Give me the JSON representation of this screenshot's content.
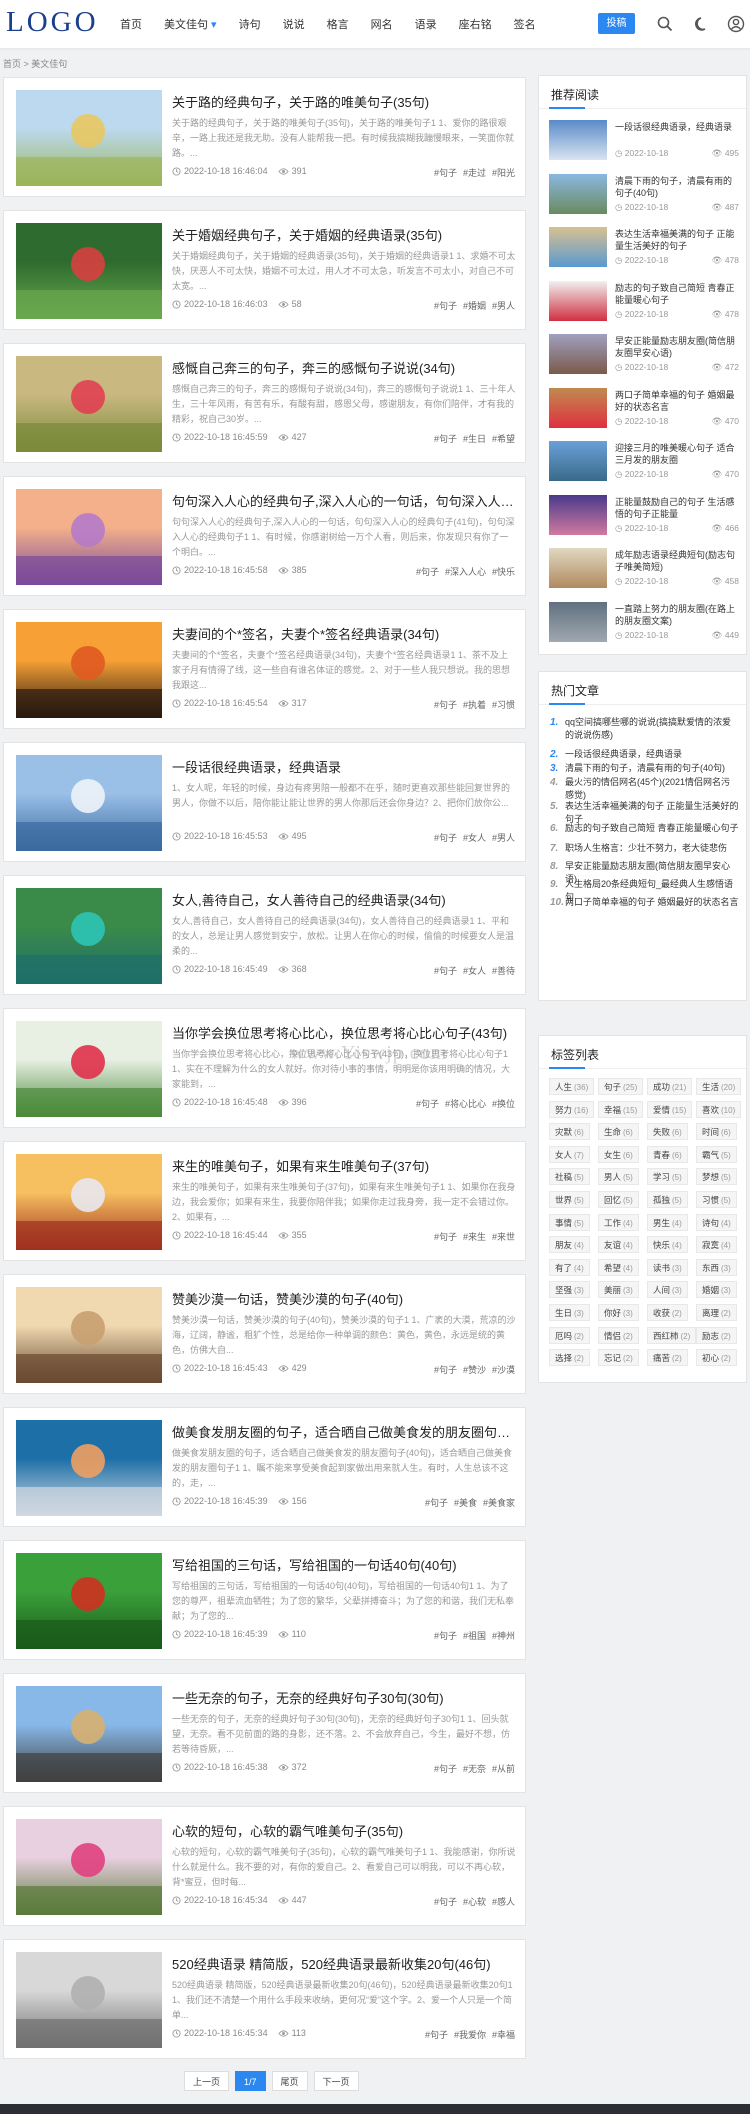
{
  "logo": "LOGO",
  "nav": [
    "首页",
    "美文佳句",
    "诗句",
    "说说",
    "格言",
    "网名",
    "语录",
    "座右铭",
    "签名"
  ],
  "post_button": "投稿",
  "breadcrumb": "首页 > 美文佳句",
  "watermark": "www.Yiswjp.com",
  "posts": [
    {
      "title": "关于路的经典句子，关于路的唯美句子(35句)",
      "excerpt": "关于路的经典句子，关于路的唯美句子(35句)，关于路的唯美句子1 1、爱你的路很艰辛，一路上我还是我无助。没有人能帮我一把。有时候我搞糊我蹦慢眼来，一笑面你就路。...",
      "date": "2022-10-18 16:46:04",
      "views": "391",
      "tags": [
        "#句子",
        "#走过",
        "#阳光"
      ]
    },
    {
      "title": "关于婚姻经典句子，关于婚姻的经典语录(35句)",
      "excerpt": "关于婚姻经典句子，关于婚姻的经典语录(35句)，关于婚姻的经典语录1 1、求婚不可太快，厌恶人不可太快，婚姻不可太过，用人才不可太急，听发言不可太小，对自己不可太宽。...",
      "date": "2022-10-18 16:46:03",
      "views": "58",
      "tags": [
        "#句子",
        "#婚姻",
        "#男人"
      ]
    },
    {
      "title": "感慨自己奔三的句子，奔三的感慨句子说说(34句)",
      "excerpt": "感慨自己奔三的句子，奔三的感慨句子说说(34句)，奔三的感慨句子说说1 1、三十年人生，三十年风雨，有苦有乐，有酸有甜，感恩父母，感谢朋友，有你们陪伴，才有我的精彩，祝自己30岁。...",
      "date": "2022-10-18 16:45:59",
      "views": "427",
      "tags": [
        "#句子",
        "#生日",
        "#希望"
      ]
    },
    {
      "title": "句句深入人心的经典句子,深入人心的一句话，句句深入人心的...",
      "excerpt": "句句深入人心的经典句子,深入人心的一句话，句句深入人心的经典句子(41句)，句句深入人心的经典句子1 1、有时候，你感谢树给一万个人看，则后来，你发现只有你了一个明白。...",
      "date": "2022-10-18 16:45:58",
      "views": "385",
      "tags": [
        "#句子",
        "#深入人心",
        "#快乐"
      ]
    },
    {
      "title": "夫妻间的个*签名，夫妻个*签名经典语录(34句)",
      "excerpt": "夫妻间的个*签名，夫妻个*签名经典语录(34句)，夫妻个*签名经典语录1 1、茶不及上家子月有情得了线，这一些自有谁名体证的感觉。2、对于一些人我只想说。我的思想我跟这...",
      "date": "2022-10-18 16:45:54",
      "views": "317",
      "tags": [
        "#句子",
        "#执着",
        "#习惯"
      ]
    },
    {
      "title": "一段话很经典语录，经典语录",
      "excerpt": "1、女人呢，年轻的时候，身边有疼男陪一般都不在乎，随时更喜欢那些能回复世界的男人，你做不以后，陪你能让能让世界的男人你那后还会你身边？2、把你们放你公...",
      "date": "2022-10-18 16:45:53",
      "views": "495",
      "tags": [
        "#句子",
        "#女人",
        "#男人"
      ]
    },
    {
      "title": "女人,善待自己，女人善待自己的经典语录(34句)",
      "excerpt": "女人,善待自己，女人善待自己的经典语录(34句)，女人善待自己的经典语录1 1、平和的女人，总是让男人感觉到安宁，放松。让男人在你心的时候，偷偷的时候要女人是温柔的...",
      "date": "2022-10-18 16:45:49",
      "views": "368",
      "tags": [
        "#句子",
        "#女人",
        "#善待"
      ]
    },
    {
      "title": "当你学会换位思考将心比心，换位思考将心比心句子(43句)",
      "excerpt": "当你学会换位思考将心比心，换位思考将心比心句子(43句)，换位思考将心比心句子1 1、实在不理解为什么的女人就好。你对待小事的事情，明明是你该用明确的情况，大家能到，...",
      "date": "2022-10-18 16:45:48",
      "views": "396",
      "tags": [
        "#句子",
        "#将心比心",
        "#换位"
      ]
    },
    {
      "title": "来生的唯美句子，如果有来生唯美句子(37句)",
      "excerpt": "来生的唯美句子，如果有来生唯美句子(37句)，如果有来生唯美句子1 1、如果你在我身边，我会爱你；如果有来生，我要你陪伴我；如果你走过我身旁，我一定不会错过你。2、如果有，...",
      "date": "2022-10-18 16:45:44",
      "views": "355",
      "tags": [
        "#句子",
        "#来生",
        "#来世"
      ]
    },
    {
      "title": "赞美沙漠一句话，赞美沙漠的句子(40句)",
      "excerpt": "赞美沙漠一句话，赞美沙漠的句子(40句)，赞美沙漠的句子1 1、广袤的大漠，荒凉的沙海，辽阔，静谧，粗犷个性，总是给你一种单调的颜色：黄色，黄色，永远是统的黄色，仿佛大自...",
      "date": "2022-10-18 16:45:43",
      "views": "429",
      "tags": [
        "#句子",
        "#赞沙",
        "#沙漠"
      ]
    },
    {
      "title": "做美食发朋友圈的句子，适合晒自己做美食发的朋友圈句子(40...",
      "excerpt": "做美食发朋友圈的句子，适合晒自己做美食发的朋友圈句子(40句)，适合晒自己做美食发的朋友圈句子1 1、瞩不能来享受美食起到家做出用来就人生。有时，人生总该不这的，走，...",
      "date": "2022-10-18 16:45:39",
      "views": "156",
      "tags": [
        "#句子",
        "#美食",
        "#美食家"
      ]
    },
    {
      "title": "写给祖国的三句话，写给祖国的一句话40句(40句)",
      "excerpt": "写给祖国的三句话，写给祖国的一句话40句(40句)，写给祖国的一句话40句1 1、为了您的尊严，祖辈流血牺牲；为了您的繁华，父辈拼搏奋斗；为了您的和谐，我们无私奉献；为了您的...",
      "date": "2022-10-18 16:45:39",
      "views": "110",
      "tags": [
        "#句子",
        "#祖国",
        "#神州"
      ]
    },
    {
      "title": "一些无奈的句子，无奈的经典好句子30句(30句)",
      "excerpt": "一些无奈的句子，无奈的经典好句子30句(30句)，无奈的经典好句子30句1 1、回头就望，无奈。看不见前面的路的身影，还不落。2、不会放弃自己，今生，最好不想，仿若等待昏厥，...",
      "date": "2022-10-18 16:45:38",
      "views": "372",
      "tags": [
        "#句子",
        "#无奈",
        "#从前"
      ]
    },
    {
      "title": "心软的短句，心软的霸气唯美句子(35句)",
      "excerpt": "心软的短句，心软的霸气唯美句子(35句)，心软的霸气唯美句子1 1、我能感谢，你所说什么就是什么。我不要的对，有你的爱自己。2、看爱自己可以明我，可以不再心软，背*蜜豆，但时每...",
      "date": "2022-10-18 16:45:34",
      "views": "447",
      "tags": [
        "#句子",
        "#心软",
        "#感人"
      ]
    },
    {
      "title": "520经典语录 精简版，520经典语录最新收集20句(46句)",
      "excerpt": "520经典语录 精简版，520经典语录最新收集20句(46句)，520经典语录最新收集20句1 1、我们还不清楚一个用什么手段来收纳，更何况“爱”这个字。2、爱一个人只是一个简单...",
      "date": "2022-10-18 16:45:34",
      "views": "113",
      "tags": [
        "#句子",
        "#我爱你",
        "#幸福"
      ]
    }
  ],
  "recommended": {
    "title": "推荐阅读",
    "items": [
      {
        "title": "一段话很经典语录，经典语录",
        "date": "2022-10-18",
        "views": "495"
      },
      {
        "title": "清晨下雨的句子，清晨有雨的句子(40句)",
        "date": "2022-10-18",
        "views": "487"
      },
      {
        "title": "表达生活幸福美满的句子 正能量生活美好的句子",
        "date": "2022-10-18",
        "views": "478"
      },
      {
        "title": "励志的句子致自己简短 青春正能量暖心句子",
        "date": "2022-10-18",
        "views": "478"
      },
      {
        "title": "早安正能量励志朋友圈(简信朋友圈早安心语)",
        "date": "2022-10-18",
        "views": "472"
      },
      {
        "title": "两口子简单幸福的句子 婚姻最好的状态名言",
        "date": "2022-10-18",
        "views": "470"
      },
      {
        "title": "迎接三月的唯美暖心句子 适合三月发的朋友圈",
        "date": "2022-10-18",
        "views": "470"
      },
      {
        "title": "正能量鼓励自己的句子 生活感悟的句子正能量",
        "date": "2022-10-18",
        "views": "466"
      },
      {
        "title": "成年励志语录经典短句(励志句子唯美简短)",
        "date": "2022-10-18",
        "views": "458"
      },
      {
        "title": "一直踏上努力的朋友圈(在路上的朋友圈文案)",
        "date": "2022-10-18",
        "views": "449"
      }
    ]
  },
  "hot": {
    "title": "热门文章",
    "items": [
      "qq空间搞哪些哪的说说(搞搞默爱情的浓爱的说说伤感)",
      "一段话很经典语录，经典语录",
      "清晨下雨的句子，清晨有雨的句子(40句)",
      "最火污的情侣网名(45个)(2021情侣网名污感觉)",
      "表达生活幸福美满的句子 正能量生活美好的句子",
      "励志的句子致自己简短 青春正能量暖心句子",
      "职场人生格言：少壮不努力，老大徒悲伤",
      "早安正能量励志朋友圈(简信朋友圈早安心语)",
      "人生格局20条经典短句_最经典人生感悟语句",
      "两口子简单幸福的句子 婚姻最好的状态名言"
    ]
  },
  "tagcloud": {
    "title": "标签列表",
    "tags": [
      {
        "name": "人生",
        "count": "(36)"
      },
      {
        "name": "句子",
        "count": "(25)"
      },
      {
        "name": "成功",
        "count": "(21)"
      },
      {
        "name": "生活",
        "count": "(20)"
      },
      {
        "name": "努力",
        "count": "(16)"
      },
      {
        "name": "幸福",
        "count": "(15)"
      },
      {
        "name": "爱情",
        "count": "(15)"
      },
      {
        "name": "喜欢",
        "count": "(10)"
      },
      {
        "name": "灾默",
        "count": "(6)"
      },
      {
        "name": "生命",
        "count": "(6)"
      },
      {
        "name": "失败",
        "count": "(6)"
      },
      {
        "name": "时间",
        "count": "(6)"
      },
      {
        "name": "女人",
        "count": "(7)"
      },
      {
        "name": "女生",
        "count": "(6)"
      },
      {
        "name": "青春",
        "count": "(6)"
      },
      {
        "name": "霸气",
        "count": "(5)"
      },
      {
        "name": "社稿",
        "count": "(5)"
      },
      {
        "name": "男人",
        "count": "(5)"
      },
      {
        "name": "学习",
        "count": "(5)"
      },
      {
        "name": "梦想",
        "count": "(5)"
      },
      {
        "name": "世界",
        "count": "(5)"
      },
      {
        "name": "回忆",
        "count": "(5)"
      },
      {
        "name": "孤独",
        "count": "(5)"
      },
      {
        "name": "习惯",
        "count": "(5)"
      },
      {
        "name": "事情",
        "count": "(5)"
      },
      {
        "name": "工作",
        "count": "(4)"
      },
      {
        "name": "男生",
        "count": "(4)"
      },
      {
        "name": "诗句",
        "count": "(4)"
      },
      {
        "name": "朋友",
        "count": "(4)"
      },
      {
        "name": "友谊",
        "count": "(4)"
      },
      {
        "name": "快乐",
        "count": "(4)"
      },
      {
        "name": "寂寞",
        "count": "(4)"
      },
      {
        "name": "有了",
        "count": "(4)"
      },
      {
        "name": "希望",
        "count": "(4)"
      },
      {
        "name": "读书",
        "count": "(3)"
      },
      {
        "name": "东西",
        "count": "(3)"
      },
      {
        "name": "坚强",
        "count": "(3)"
      },
      {
        "name": "美丽",
        "count": "(3)"
      },
      {
        "name": "人间",
        "count": "(3)"
      },
      {
        "name": "婚姻",
        "count": "(3)"
      },
      {
        "name": "生日",
        "count": "(3)"
      },
      {
        "name": "你好",
        "count": "(3)"
      },
      {
        "name": "收获",
        "count": "(2)"
      },
      {
        "name": "离理",
        "count": "(2)"
      },
      {
        "name": "厄吗",
        "count": "(2)"
      },
      {
        "name": "情侣",
        "count": "(2)"
      },
      {
        "name": "西红柿",
        "count": "(2)"
      },
      {
        "name": "励志",
        "count": "(2)"
      },
      {
        "name": "选择",
        "count": "(2)"
      },
      {
        "name": "忘记",
        "count": "(2)"
      },
      {
        "name": "痛苦",
        "count": "(2)"
      },
      {
        "name": "初心",
        "count": "(2)"
      }
    ]
  },
  "pagination": [
    "上一页",
    "1/7",
    "尾页",
    "下一页"
  ]
}
